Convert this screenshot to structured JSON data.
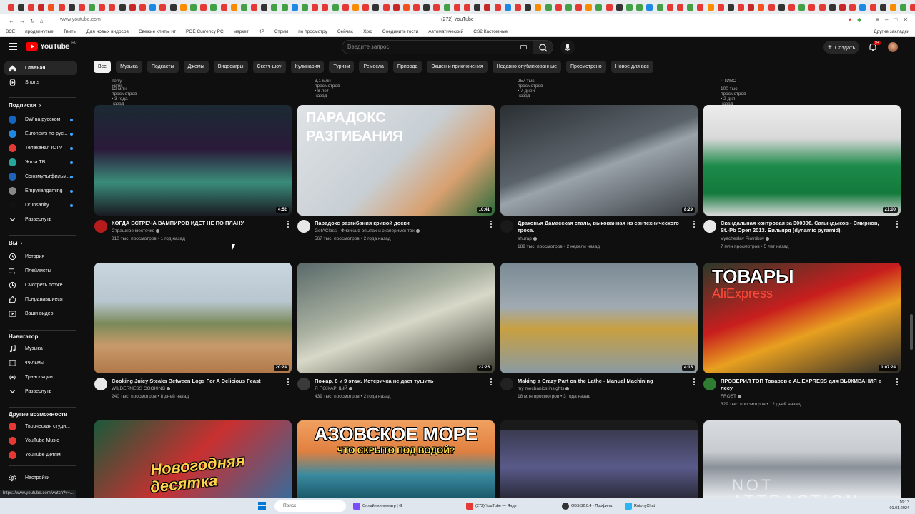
{
  "browser": {
    "url": "www.youtube.com",
    "title": "(272) YouTube",
    "bookmarks": [
      "ВСЕ",
      "продвинутые",
      "Твиты",
      "Для новых видосов",
      "Свежие клипы ит",
      "POE Currency PC",
      "маркет",
      "КР",
      "Стрим",
      "по просмотру",
      "Сейчас",
      "Хрю",
      "Соединить гости",
      "Автоматический",
      "CS2 Кастомные"
    ],
    "bookmarks_other": "Другие закладки",
    "status_url": "https://www.youtube.com/watch?v=..."
  },
  "header": {
    "logo_text": "YouTube",
    "region": "RU",
    "search_placeholder": "Введите запрос",
    "create_label": "Создать",
    "notif_count": "9+"
  },
  "chips": [
    "Все",
    "Музыка",
    "Подкасты",
    "Джемы",
    "Видеоигры",
    "Скетч-шоу",
    "Кулинария",
    "Туризм",
    "Ремесла",
    "Природа",
    "Экшен и приключения",
    "Недавно опубликованные",
    "Просмотрено",
    "Новое для вас"
  ],
  "sidebar": {
    "main": [
      {
        "label": "Главная",
        "icon": "home-icon"
      },
      {
        "label": "Shorts",
        "icon": "shorts-icon"
      }
    ],
    "subs_title": "Подписки",
    "subs": [
      {
        "label": "DW на русском",
        "color": "#1565c0"
      },
      {
        "label": "Euronews по-рус...",
        "color": "#1e88e5"
      },
      {
        "label": "Телеканал ICTV",
        "color": "#e53935"
      },
      {
        "label": "Жиза ТВ",
        "color": "#26a69a"
      },
      {
        "label": "Союзмультфильм...",
        "color": "#1e63b8"
      },
      {
        "label": "Empyriangaming",
        "color": "#888888"
      },
      {
        "label": "Dr Insanity",
        "color": "#111111"
      },
      {
        "label": "Развернуть",
        "color": ""
      }
    ],
    "you_title": "Вы",
    "you": [
      {
        "label": "История",
        "icon": "history-icon"
      },
      {
        "label": "Плейлисты",
        "icon": "playlist-icon"
      },
      {
        "label": "Смотреть позже",
        "icon": "clock-icon"
      },
      {
        "label": "Понравившиеся",
        "icon": "thumbs-up-icon"
      },
      {
        "label": "Ваши видео",
        "icon": "video-icon"
      }
    ],
    "nav_title": "Навигатор",
    "nav": [
      {
        "label": "Музыка",
        "icon": "music-icon"
      },
      {
        "label": "Фильмы",
        "icon": "film-icon"
      },
      {
        "label": "Трансляции",
        "icon": "live-icon"
      },
      {
        "label": "Развернуть",
        "icon": "chevron-down-icon"
      }
    ],
    "more_title": "Другие возможности",
    "more": [
      {
        "label": "Творческая студи...",
        "color": "#e53935"
      },
      {
        "label": "YouTube Music",
        "color": "#e53935"
      },
      {
        "label": "YouTube Детям",
        "color": "#e53935"
      }
    ],
    "settings": "Настройки"
  },
  "top_partial": [
    {
      "line1": "Terry Films",
      "line2": "12 млн просмотров • 3 года назад"
    },
    {
      "line1": "",
      "line2": "3,1 млн просмотров • 8 лет назад"
    },
    {
      "line1": "",
      "line2": "257 тыс. просмотров • 7 дней назад"
    },
    {
      "line1": "ЧТИВО",
      "line2": "100 тыс. просмотров • 2 дня назад"
    }
  ],
  "videos": [
    {
      "title": "КОГДА ВСТРЕЧА ВАМПИРОВ ИДЕТ НЕ ПО ПЛАНУ",
      "title2": "",
      "channel": "Страшное местечко",
      "meta": "310 тыс. просмотров • 1 год назад",
      "duration": "4:52"
    },
    {
      "title": "Парадокс разгибания кривой доски",
      "title2": "",
      "channel": "GetAClass - Физика в опытах и экспериментах",
      "meta": "567 тыс. просмотров • 2 года назад",
      "duration": "10:41",
      "overlay": [
        "ПАРАДОКС",
        "РАЗГИБАНИЯ"
      ]
    },
    {
      "title": "Драконья Дамасская сталь, выкованная из сантехнического",
      "title2": "троса.",
      "channel": "shurap",
      "meta": "189 тыс. просмотров • 2 недели назад",
      "duration": "8:29"
    },
    {
      "title": "Скандальная контровая за 30000€. Сагындыков - Смирнов,",
      "title2": "St.-Pb Open 2013. Бильярд (dynamic pyramid).",
      "channel": "Vyacheslav Piotnikov",
      "meta": "7 млн просмотров • 5 лет назад",
      "duration": "21:00"
    },
    {
      "title": "Cooking Juicy Steaks Between Logs For A Delicious Feast",
      "title2": "",
      "channel": "WILDERNESS COOKING",
      "meta": "240 тыс. просмотров • 8 дней назад",
      "duration": "20:24"
    },
    {
      "title": "Пожар, 8 и 9 этаж.  Истеричка не дает тушить",
      "title2": "",
      "channel": "Я ПОЖАРНЫЙ",
      "meta": "439 тыс. просмотров • 2 года назад",
      "duration": "22:25"
    },
    {
      "title": "Making a Crazy Part on the Lathe - Manual Machining",
      "title2": "",
      "channel": "my mechanics insights",
      "meta": "18 млн просмотров • 3 года назад",
      "duration": "4:15"
    },
    {
      "title": "ПРОВЕРИЛ ТОП Товаров с ALIEXPRESS для ВЫЖИВАНИЯ в",
      "title2": "лесу",
      "channel": "FROST",
      "meta": "329 тыс. просмотров • 12 дней назад",
      "duration": "1:07:24",
      "overlay": [
        "ТОВАРЫ",
        "AliExpress"
      ]
    },
    {
      "title": "",
      "title2": "",
      "channel": "",
      "meta": "",
      "duration": "",
      "overlay": [
        "Новогодняя",
        "десятка"
      ]
    },
    {
      "title": "",
      "title2": "",
      "channel": "",
      "meta": "",
      "duration": "",
      "overlay": [
        "АЗОВСКОЕ МОРЕ",
        "ЧТО СКРЫТО ПОД ВОДОЙ?"
      ]
    },
    {
      "title": "",
      "title2": "",
      "channel": "",
      "meta": "",
      "duration": ""
    },
    {
      "title": "",
      "title2": "",
      "channel": "",
      "meta": "",
      "duration": "",
      "overlay": [
        "NOT ATTRACTION"
      ]
    }
  ],
  "taskbar": {
    "search": "Поиск",
    "apps": [
      "Онлайн кинотеатр | G",
      "(272) YouTube — Янде",
      "OBS 32.0.4 - Профиль:",
      "RutonyChat"
    ],
    "time": "16:13",
    "date": "01.01.2024"
  },
  "colors": {
    "bg": "#0f0f0f",
    "chip": "#272727",
    "red": "#ff0000",
    "meta": "#aaaaaa"
  }
}
